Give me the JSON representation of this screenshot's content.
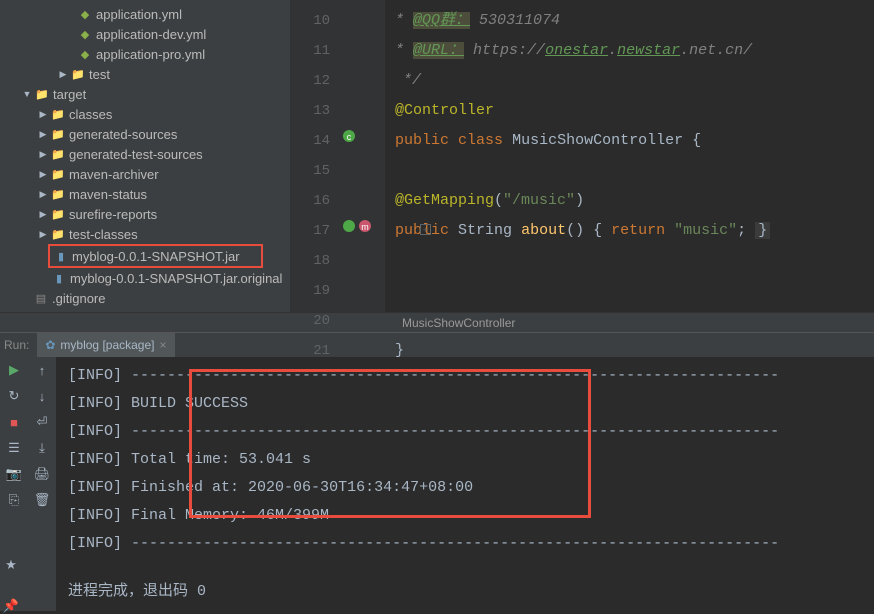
{
  "tree": {
    "app_yml": "application.yml",
    "app_dev_yml": "application-dev.yml",
    "app_pro_yml": "application-pro.yml",
    "test": "test",
    "target": "target",
    "classes": "classes",
    "gen_sources": "generated-sources",
    "gen_test_sources": "generated-test-sources",
    "maven_archiver": "maven-archiver",
    "maven_status": "maven-status",
    "surefire": "surefire-reports",
    "test_classes": "test-classes",
    "jar": "myblog-0.0.1-SNAPSHOT.jar",
    "jar_orig": "myblog-0.0.1-SNAPSHOT.jar.original",
    "gitignore": ".gitignore"
  },
  "line_nums": [
    "10",
    "11",
    "12",
    "13",
    "14",
    "15",
    "16",
    "17",
    "18",
    "19",
    "20",
    "21"
  ],
  "code": {
    "qq_label": "@QQ群：",
    "qq_value": "530311074",
    "url_label": "@URL：",
    "url_proto": "https://",
    "url_host1": "onestar",
    "url_host2": "newstar",
    "url_rest": ".net.cn/",
    "comment_end": "*/",
    "controller": "@Controller",
    "public": "public",
    "class": "class",
    "classname": "MusicShowController",
    "getmapping": "@GetMapping",
    "getmapping_val": "\"/music\"",
    "string": "String",
    "about": "about",
    "return": "return",
    "music": "\"music\""
  },
  "breadcrumb": "MusicShowController",
  "run": {
    "label": "Run:",
    "tab": "myblog [package]",
    "info": "[INFO]",
    "dashes": "------------------------------------------------------------------------",
    "build_success": "BUILD SUCCESS",
    "total_time": "Total time: 53.041 s",
    "finished": "Finished at: 2020-06-30T16:34:47+08:00",
    "memory": "Final Memory: 46M/399M",
    "exit": "进程完成，退出码 0"
  }
}
